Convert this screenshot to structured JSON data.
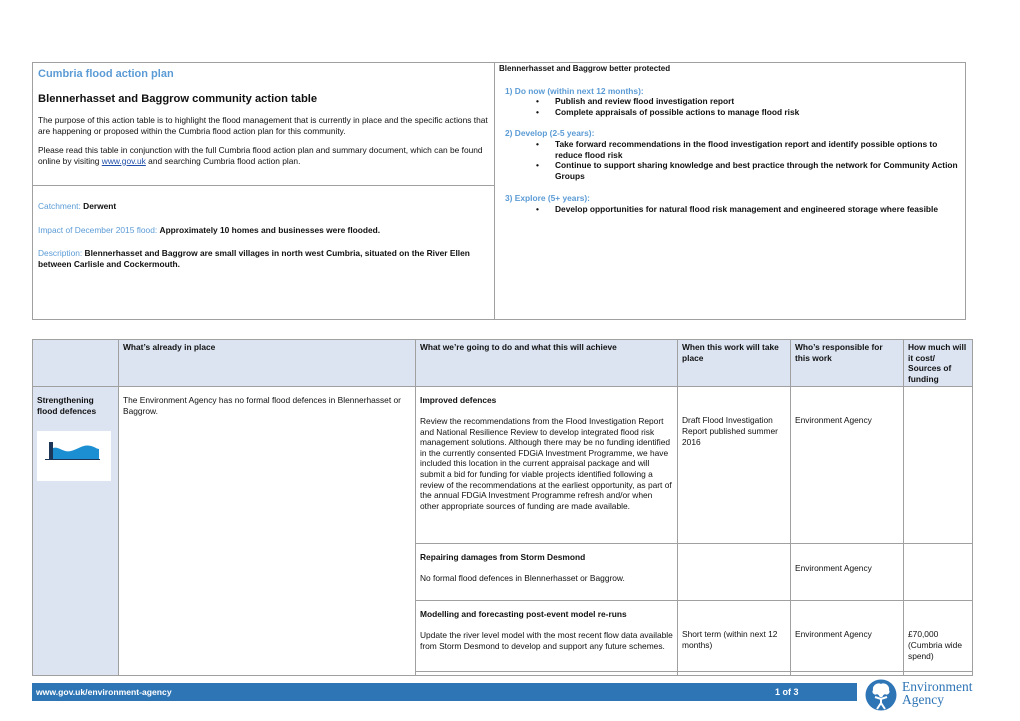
{
  "summary": {
    "plan_title": "Cumbria flood action plan",
    "table_title": "Blennerhasset and Baggrow community action table",
    "purpose": "The purpose of this action table is to highlight the flood management that is currently in place and the specific actions that are happening or proposed within the Cumbria flood action plan for this community.",
    "read_prefix": "Please read this table in conjunction with the full Cumbria flood action plan and summary document, which can be found online by visiting ",
    "read_link": "www.gov.uk",
    "read_suffix": " and searching Cumbria flood action plan.",
    "catchment_label": "Catchment: ",
    "catchment_value": "Derwent",
    "impact_label": "Impact of December 2015 flood: ",
    "impact_value": "Approximately 10 homes and businesses were flooded.",
    "description_label": "Description: ",
    "description_value": "Blennerhasset and Baggrow are small villages in north west Cumbria, situated on the River Ellen between Carlisle and Cockermouth."
  },
  "protection": {
    "heading": "Blennerhasset and Baggrow better protected",
    "steps": [
      {
        "label": "1)  Do now (within next 12 months):",
        "items": [
          "Publish and review flood investigation report",
          "Complete appraisals of possible actions to manage flood risk"
        ]
      },
      {
        "label": "2)  Develop (2-5 years):",
        "items": [
          "Take forward recommendations in the flood investigation report and identify possible options to reduce flood risk",
          "Continue to support sharing knowledge and best practice through the network for Community Action Groups"
        ]
      },
      {
        "label": "3)  Explore (5+ years):",
        "items": [
          "Develop opportunities for natural flood risk management and engineered storage where feasible"
        ]
      }
    ]
  },
  "action_table": {
    "headers": [
      "",
      "What’s already in place",
      "What we’re going to do and what this will achieve",
      "When this work will take place",
      "Who’s responsible for this work",
      "How much will it cost/ Sources of funding"
    ],
    "category": "Strengthening flood defences",
    "category_icon": "flood-defence-wall-icon",
    "already_in_place": "The Environment Agency has no formal flood defences in Blennerhasset or Baggrow.",
    "rows": [
      {
        "title": "Improved defences",
        "body": "Review the recommendations from the Flood Investigation Report and National Resilience Review to develop integrated flood risk management solutions. Although there may be no funding identified in the currently consented FDGiA Investment Programme, we have included this location in the current appraisal package and will submit a bid for funding for viable projects identified following a review of the recommendations at the earliest opportunity, as part of the annual FDGiA Investment Programme refresh and/or when other appropriate sources of funding are made available.",
        "when": "Draft Flood Investigation Report published summer 2016",
        "who": "Environment Agency",
        "cost": ""
      },
      {
        "title": "Repairing damages from Storm Desmond",
        "body": "No formal flood defences in Blennerhasset or Baggrow.",
        "when": "",
        "who": "Environment Agency",
        "cost": ""
      },
      {
        "title": "Modelling and forecasting post-event model re-runs",
        "body": "Update the river level model with the most recent flow data available from Storm Desmond to develop and support any future schemes.",
        "when": "Short term (within next 12 months)",
        "who": "Environment Agency",
        "cost": "£70,000 (Cumbria wide spend)"
      }
    ]
  },
  "footer": {
    "url": "www.gov.uk/environment-agency",
    "page": "1 of 3",
    "logo_line1": "Environment",
    "logo_line2": "Agency"
  },
  "colors": {
    "accent_blue": "#5b9bd5",
    "header_fill": "#dce4f2",
    "footer_blue": "#2e75b6"
  }
}
